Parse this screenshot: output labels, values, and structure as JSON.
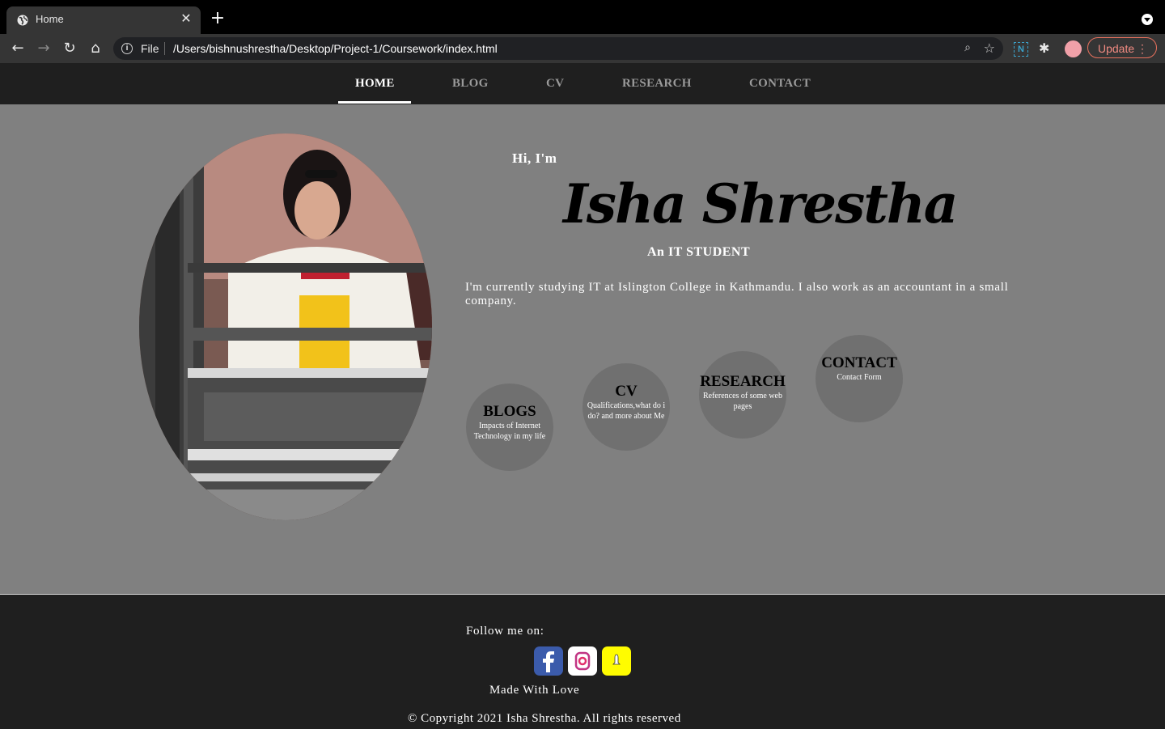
{
  "browser": {
    "tab_title": "Home",
    "tab_close": "✕",
    "new_tab": "+",
    "back": "←",
    "forward": "→",
    "reload": "↻",
    "home": "⌂",
    "info": "i",
    "scheme": "File",
    "url": "/Users/bishnushrestha/Desktop/Project-1/Coursework/index.html",
    "zoom_icon": "⌕",
    "star_icon": "☆",
    "ext_n": "N",
    "ext_puzzle": "✱",
    "update_label": "Update",
    "update_menu": "⋮"
  },
  "nav": {
    "items": [
      {
        "label": "HOME",
        "active": true
      },
      {
        "label": "BLOG",
        "active": false
      },
      {
        "label": "CV",
        "active": false
      },
      {
        "label": "RESEARCH",
        "active": false
      },
      {
        "label": "CONTACT",
        "active": false
      }
    ]
  },
  "hero": {
    "greeting": "Hi, I'm",
    "name": "Isha Shrestha",
    "role": "An IT STUDENT",
    "bio": "I'm currently studying IT at Islington College in Kathmandu. I also work as an accountant in a small company."
  },
  "cards": [
    {
      "title": "BLOGS",
      "subtitle": "Impacts of Internet Technology in my life"
    },
    {
      "title": "CV",
      "subtitle": "Qualifications,what do i do? and more about Me"
    },
    {
      "title": "RESEARCH",
      "subtitle": "References of some web pages"
    },
    {
      "title": "CONTACT",
      "subtitle": "Contact Form"
    }
  ],
  "footer": {
    "follow": "Follow me on:",
    "social": [
      "facebook-icon",
      "instagram-icon",
      "snapchat-icon"
    ],
    "made_with": "Made With Love",
    "copyright": "© Copyright 2021 Isha Shrestha. All rights reserved"
  },
  "colors": {
    "page_bg": "#808080",
    "nav_bg": "#1f1f1f",
    "card_bg": "#707070",
    "update_accent": "#f28b82"
  }
}
